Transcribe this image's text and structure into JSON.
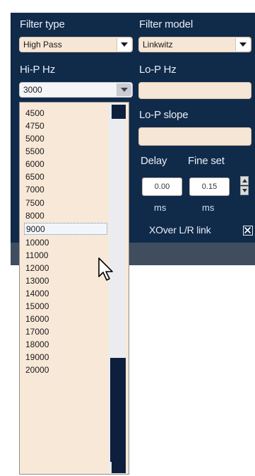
{
  "panel": {
    "filter_type": {
      "label": "Filter type",
      "value": "High Pass"
    },
    "filter_model": {
      "label": "Filter model",
      "value": "Linkwitz"
    },
    "hip_hz": {
      "label": "Hi-P Hz",
      "value": "3000"
    },
    "lop_hz": {
      "label": "Lo-P Hz",
      "value": ""
    },
    "lop_slope": {
      "label": "Lo-P slope",
      "value": ""
    },
    "delay": {
      "label": "Delay",
      "value": "0.00",
      "unit": "ms"
    },
    "fine_set": {
      "label": "Fine set",
      "value": "0.15",
      "unit": "ms"
    },
    "xover_link": {
      "label": "XOver L/R link",
      "checked": true
    }
  },
  "dropdown": {
    "options": [
      "4500",
      "4750",
      "5000",
      "5500",
      "6000",
      "6500",
      "7000",
      "7500",
      "8000",
      "9000",
      "10000",
      "11000",
      "12000",
      "13000",
      "14000",
      "15000",
      "16000",
      "17000",
      "18000",
      "19000",
      "20000"
    ],
    "hovered": "9000"
  },
  "colors": {
    "panel_bg": "#102a4a",
    "field_bg": "#f6e6d6",
    "list_bg": "#f8e8d8"
  },
  "icons": {
    "dropdown_arrow": "chevron-down-icon",
    "cursor": "mouse-pointer-icon",
    "checkbox": "checkbox-x-icon"
  }
}
